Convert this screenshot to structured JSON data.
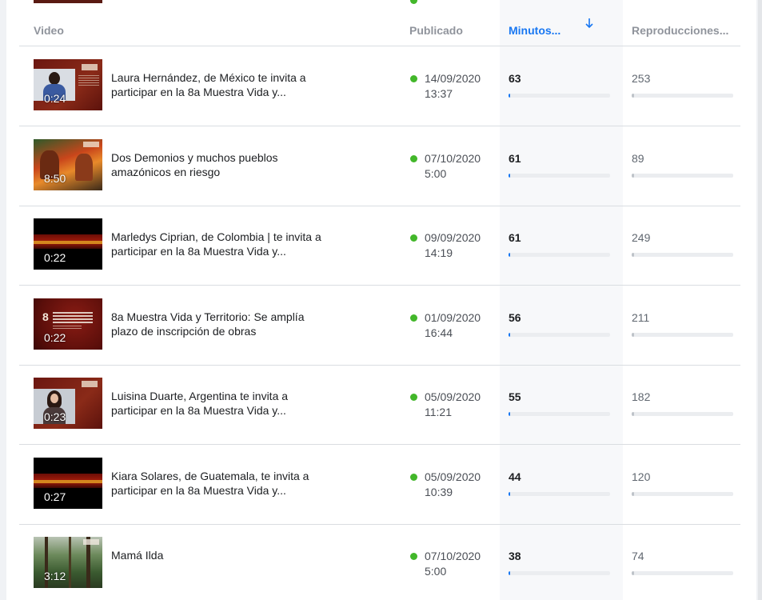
{
  "columns": {
    "video": "Video",
    "published": "Publicado",
    "minutes": "Minutos...",
    "views": "Reproducciones..."
  },
  "sort": {
    "column": "minutes",
    "direction": "descending",
    "icon": "arrow-down-icon"
  },
  "colors": {
    "accent": "#1877f2",
    "status_published": "#42b72a",
    "bar_track": "#ebedf0",
    "views_bar": "#bec3c9"
  },
  "rows": [
    {
      "thumb_style": "person",
      "duration": "0:24",
      "title": "Laura Hernández, de México te invita a participar en la 8a Muestra Vida y...",
      "date": "14/09/2020",
      "time": "13:37",
      "minutes": "63",
      "views": "253",
      "minutes_fill": 0.01,
      "views_fill": 0.02
    },
    {
      "thumb_style": "mural",
      "duration": "8:50",
      "title": "Dos Demonios y muchos pueblos amazónicos en riesgo",
      "date": "07/10/2020",
      "time": "5:00",
      "minutes": "61",
      "views": "89",
      "minutes_fill": 0.01,
      "views_fill": 0.01
    },
    {
      "thumb_style": "black",
      "duration": "0:22",
      "title": "Marledys Ciprian, de Colombia | te invita a participar en la 8a Muestra Vida y...",
      "date": "09/09/2020",
      "time": "14:19",
      "minutes": "61",
      "views": "249",
      "minutes_fill": 0.01,
      "views_fill": 0.02
    },
    {
      "thumb_style": "poster",
      "duration": "0:22",
      "title": "8a Muestra Vida y Territorio: Se amplía plazo de inscripción de obras",
      "date": "01/09/2020",
      "time": "16:44",
      "minutes": "56",
      "views": "211",
      "minutes_fill": 0.01,
      "views_fill": 0.02
    },
    {
      "thumb_style": "person2",
      "duration": "0:23",
      "title": "Luisina Duarte, Argentina te invita a participar en la 8a Muestra Vida y...",
      "date": "05/09/2020",
      "time": "11:21",
      "minutes": "55",
      "views": "182",
      "minutes_fill": 0.01,
      "views_fill": 0.02
    },
    {
      "thumb_style": "black",
      "duration": "0:27",
      "title": "Kiara Solares, de Guatemala, te invita a participar en la 8a Muestra Vida y...",
      "date": "05/09/2020",
      "time": "10:39",
      "minutes": "44",
      "views": "120",
      "minutes_fill": 0.01,
      "views_fill": 0.01
    },
    {
      "thumb_style": "forest",
      "duration": "3:12",
      "title": "Mamá Ilda",
      "date": "07/10/2020",
      "time": "5:00",
      "minutes": "38",
      "views": "74",
      "minutes_fill": 0.01,
      "views_fill": 0.01
    }
  ]
}
